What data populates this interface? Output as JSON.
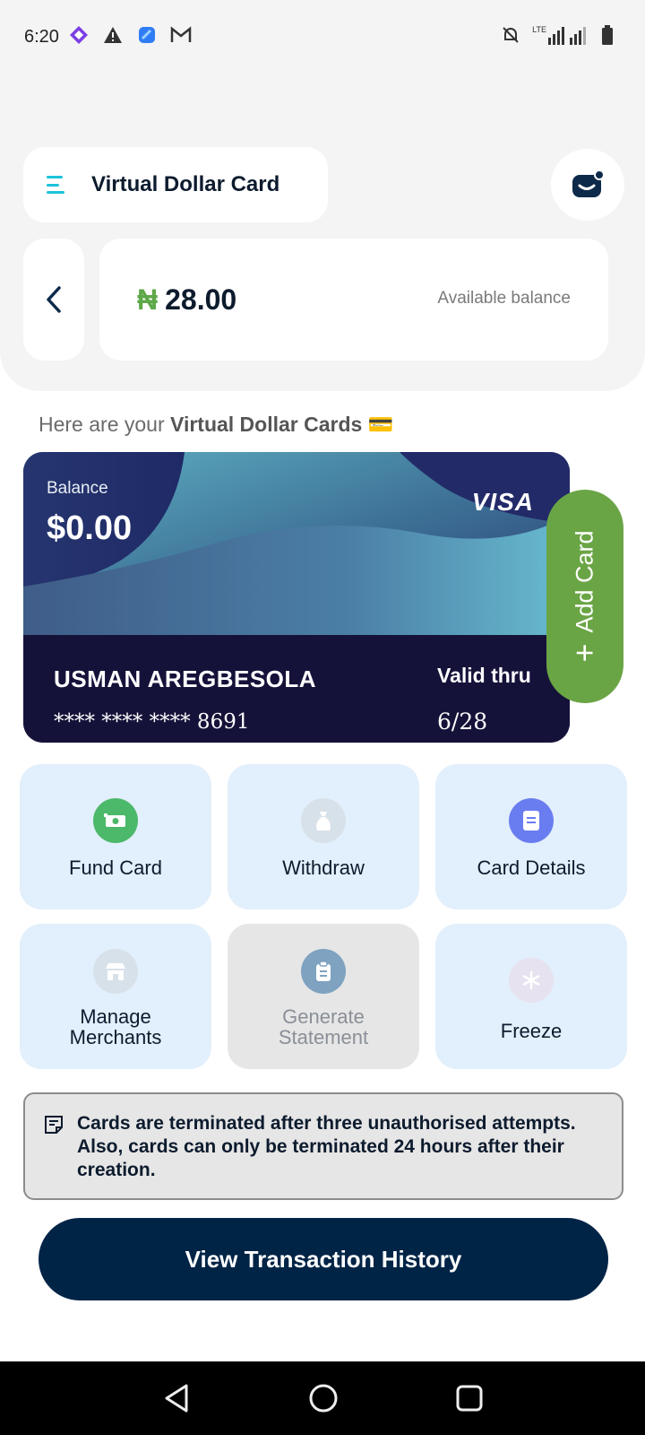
{
  "status_bar": {
    "time": "6:20",
    "network": "LTE"
  },
  "header": {
    "title": "Virtual Dollar Card",
    "balance_currency": "₦",
    "balance_amount": "28.00",
    "balance_label": "Available balance"
  },
  "intro": {
    "prefix": "Here are your ",
    "emphasis": "Virtual Dollar Cards",
    "emoji": "💳"
  },
  "card": {
    "balance_label": "Balance",
    "balance": "$0.00",
    "brand": "VISA",
    "holder": "USMAN AREGBESOLA",
    "number": "**** **** **** 8691",
    "valid_label": "Valid thru",
    "valid_value": "6/28"
  },
  "add_card": {
    "label": "Add Card"
  },
  "actions": [
    {
      "label": "Fund Card",
      "icon": "money-icon",
      "color": "#4cb86a"
    },
    {
      "label": "Withdraw",
      "icon": "money-bag-icon",
      "color": "#d7e1ea"
    },
    {
      "label": "Card Details",
      "icon": "document-icon",
      "color": "#6a7df0"
    },
    {
      "label": "Manage Merchants",
      "icon": "store-icon",
      "color": "#d7e1ea"
    },
    {
      "label": "Generate Statement",
      "icon": "clipboard-icon",
      "color": "#7ea2bf"
    },
    {
      "label": "Freeze",
      "icon": "snowflake-icon",
      "color": "#e7e2ef"
    }
  ],
  "notice": {
    "text": "Cards are terminated after three unauthorised attempts. Also, cards can only be terminated 24 hours after their creation."
  },
  "cta": {
    "label": "View Transaction History"
  },
  "colors": {
    "accent_green": "#6aa545",
    "navy": "#002446",
    "tile_bg": "#e2effc"
  }
}
